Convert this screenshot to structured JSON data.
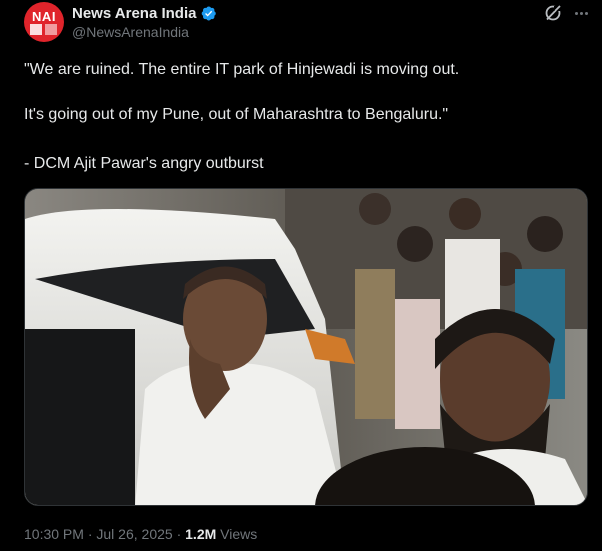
{
  "author": {
    "avatar_text": "NAI",
    "display_name": "News Arena India",
    "handle": "@NewsArenaIndia",
    "verified": true,
    "avatar_color": "#e0242b",
    "verified_color": "#1d9bf0"
  },
  "icons": {
    "grok": "grok-icon",
    "more": "more-icon",
    "verified": "verified-badge-icon"
  },
  "tweet": {
    "line1": "\"We are ruined. The entire IT park of Hinjewadi is moving out.",
    "line2": " It's going out of my Pune, out of Maharashtra to Bengaluru.\"",
    "line3": "- DCM Ajit Pawar's angry outburst"
  },
  "meta": {
    "time": "10:30 PM",
    "separator": " · ",
    "date": "Jul 26, 2025",
    "views_count": "1.2M",
    "views_label": " Views"
  }
}
